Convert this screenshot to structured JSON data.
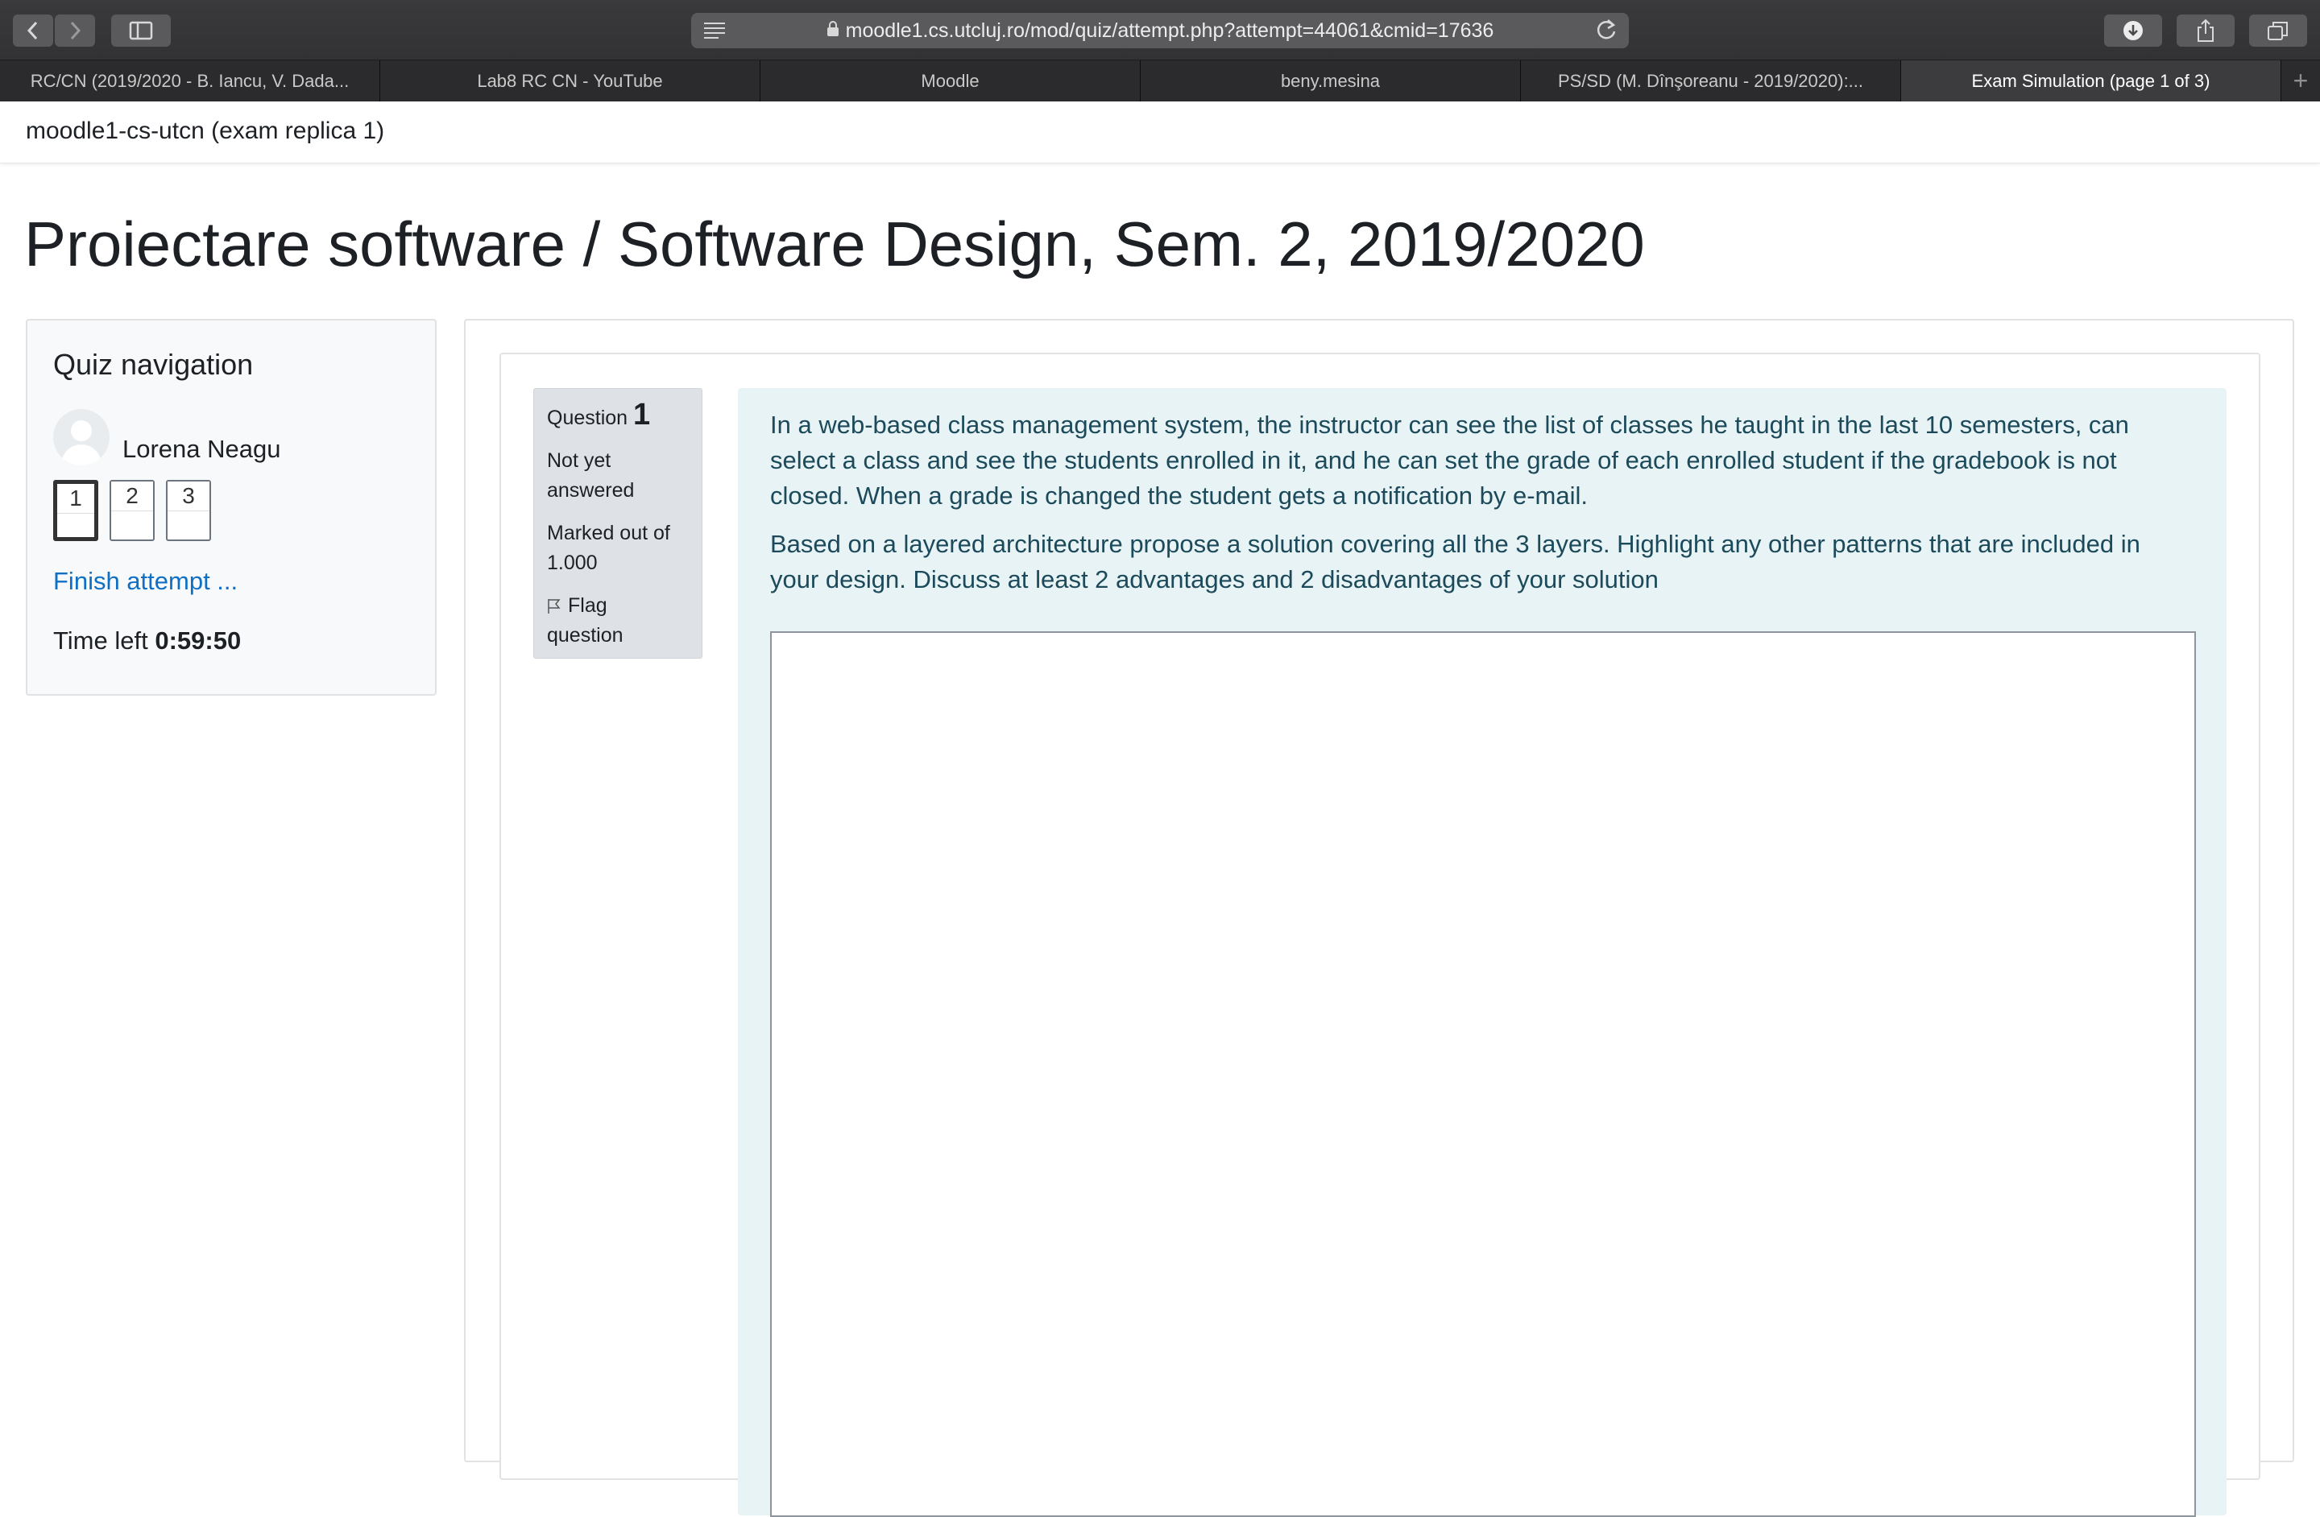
{
  "browser": {
    "url": "moodle1.cs.utcluj.ro/mod/quiz/attempt.php?attempt=44061&cmid=17636",
    "tabs": [
      {
        "label": "RC/CN (2019/2020 - B. Iancu, V. Dada..."
      },
      {
        "label": "Lab8 RC CN - YouTube"
      },
      {
        "label": "Moodle"
      },
      {
        "label": "beny.mesina"
      },
      {
        "label": "PS/SD (M. Dînşoreanu - 2019/2020):..."
      },
      {
        "label": "Exam Simulation (page 1 of 3)"
      }
    ],
    "new_tab": "+"
  },
  "site": {
    "name": "moodle1-cs-utcn (exam replica 1)"
  },
  "page": {
    "title": "Proiectare software / Software Design, Sem. 2, 2019/2020"
  },
  "quiz_nav": {
    "title": "Quiz navigation",
    "user": "Lorena Neagu",
    "questions": [
      "1",
      "2",
      "3"
    ],
    "finish_link": "Finish attempt ...",
    "time_label": "Time left",
    "time_value": "0:59:50"
  },
  "question": {
    "label": "Question",
    "number": "1",
    "status": "Not yet answered",
    "marks": "Marked out of 1.000",
    "flag": "Flag question",
    "text1": "In a web-based class management system, the instructor can see the list of classes he taught in the last 10 semesters, can select a class and see the students enrolled in it, and he can set the grade of each enrolled student if the gradebook is not closed. When a grade is changed the student gets a notification by e-mail.",
    "text2": "Based on a layered architecture propose a solution covering all the 3 layers. Highlight any other patterns that are included in your design. Discuss at least 2 advantages and 2 disadvantages of your solution",
    "answer": ""
  },
  "icons": [
    "back-icon",
    "forward-icon",
    "sidebar-icon",
    "reader-icon",
    "lock-icon",
    "reload-icon",
    "download-icon",
    "share-icon",
    "tabs-icon",
    "flag-icon",
    "avatar-icon"
  ],
  "colors": {
    "link": "#0f6fc5",
    "question_bg": "#e7f3f5",
    "question_text": "#1c4a5a",
    "info_bg": "#dee2e6"
  }
}
